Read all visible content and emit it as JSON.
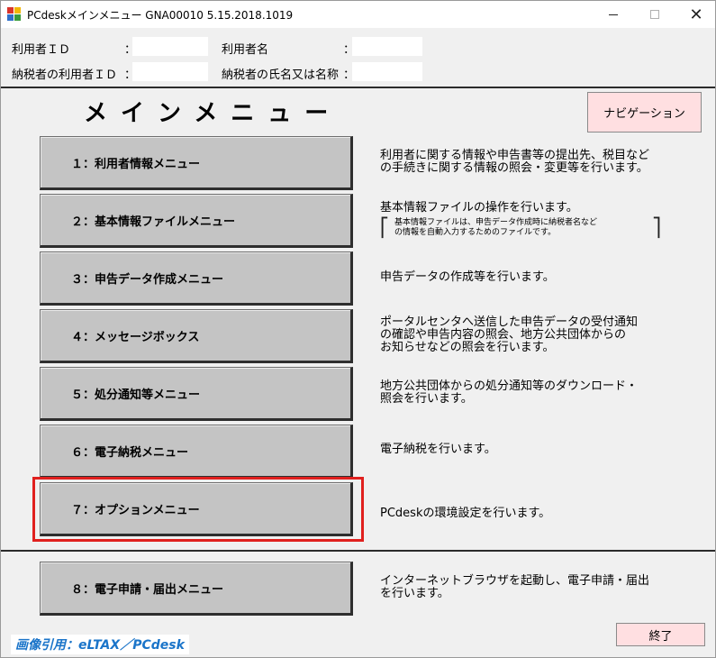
{
  "window": {
    "title": "PCdeskメインメニュー GNA00010  5.15.2018.1019",
    "minimize_icon": "minimize-icon",
    "maximize_icon": "maximize-icon",
    "close_glyph": "✕"
  },
  "user_info": {
    "user_id_label": "利用者ＩＤ",
    "user_id_colon": "：",
    "user_id_value": "",
    "user_name_label": "利用者名",
    "user_name_colon": "：",
    "user_name_value": "",
    "taxpayer_id_label": "納税者の利用者ＩＤ",
    "taxpayer_id_colon": "：",
    "taxpayer_id_value": "",
    "taxpayer_name_label": "納税者の氏名又は名称",
    "taxpayer_name_colon": "：",
    "taxpayer_name_value": ""
  },
  "main": {
    "title": "メインメニュー",
    "navigation_label": "ナビゲーション"
  },
  "menu": [
    {
      "label": "１：利用者情報メニュー",
      "description": "利用者に関する情報や申告書等の提出先、税目など\nの手続きに関する情報の照会・変更等を行います。"
    },
    {
      "label": "２：基本情報ファイルメニュー",
      "description": "基本情報ファイルの操作を行います。",
      "sub_description": "基本情報ファイルは、申告データ作成時に納税者名など\nの情報を自動入力するためのファイルです。"
    },
    {
      "label": "３：申告データ作成メニュー",
      "description": "申告データの作成等を行います。"
    },
    {
      "label": "４：メッセージボックス",
      "description": "ポータルセンタへ送信した申告データの受付通知\nの確認や申告内容の照会、地方公共団体からの\nお知らせなどの照会を行います。"
    },
    {
      "label": "５：処分通知等メニュー",
      "description": "地方公共団体からの処分通知等のダウンロード・\n照会を行います。"
    },
    {
      "label": "６：電子納税メニュー",
      "description": "電子納税を行います。"
    },
    {
      "label": "７：オプションメニュー",
      "description": "PCdeskの環境設定を行います。"
    },
    {
      "label": "８：電子申請・届出メニュー",
      "description": "インターネットブラウザを起動し、電子申請・届出\nを行います。"
    }
  ],
  "footer": {
    "exit_label": "終了",
    "citation": "画像引用：eLTAX／PCdesk"
  },
  "colors": {
    "highlight_border": "#e0201e",
    "pink_button": "#ffdfe1",
    "menu_button": "#c4c4c4",
    "citation_text": "#1a74c9"
  }
}
